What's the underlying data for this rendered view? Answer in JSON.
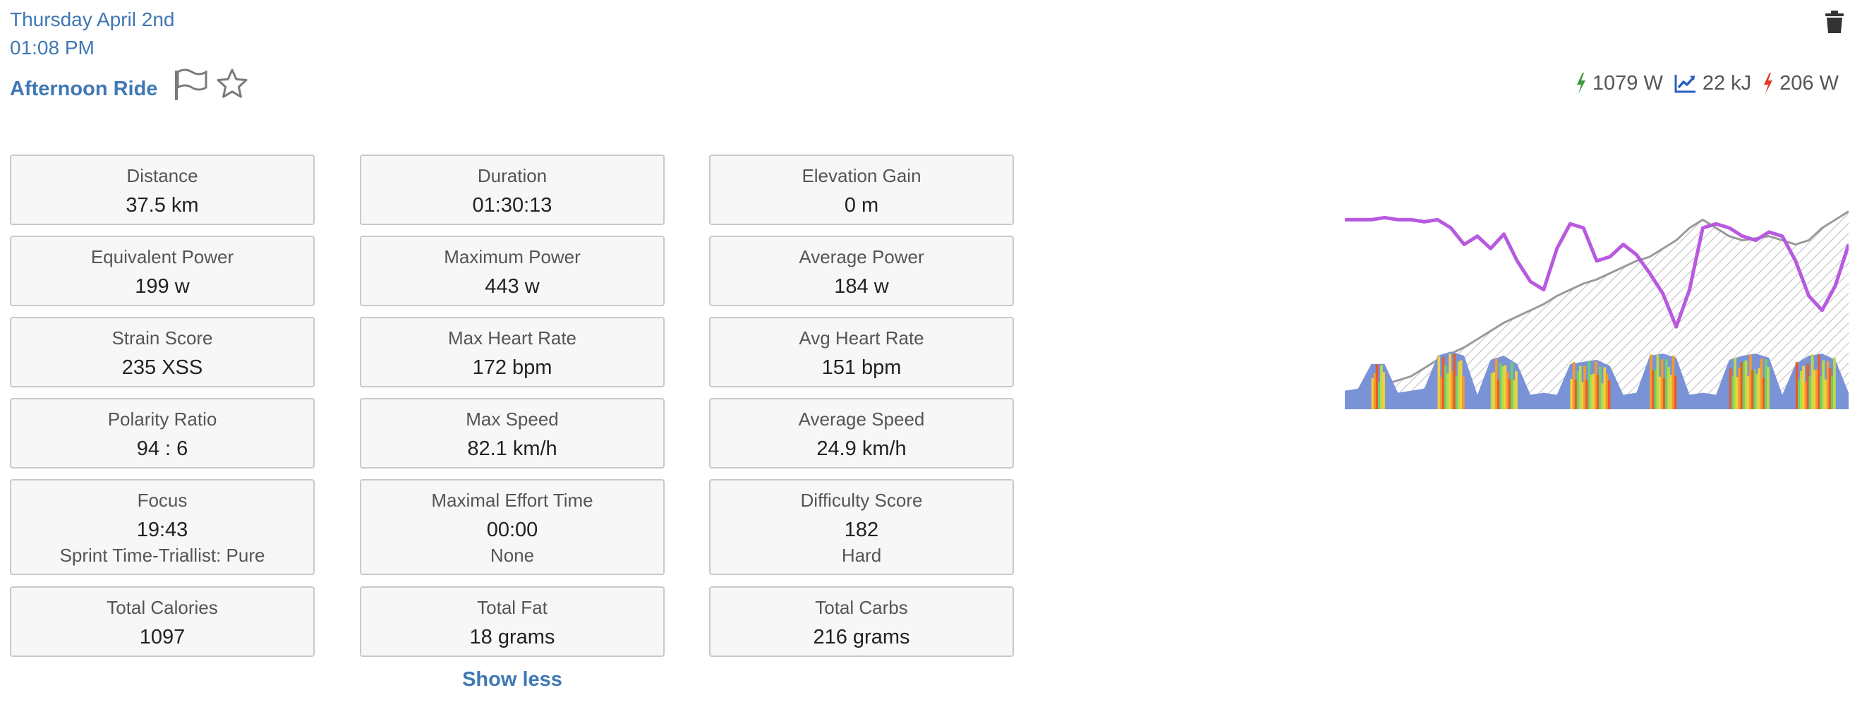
{
  "header": {
    "date": "Thursday April 2nd",
    "time": "01:08 PM",
    "title": "Afternoon Ride",
    "icons": [
      "flag-icon",
      "star-icon",
      "trash-icon"
    ]
  },
  "summary": {
    "peak_power": "1079 W",
    "work": "22 kJ",
    "threshold_power": "206 W",
    "colors": {
      "peak_power_icon": "#3a9a3a",
      "work_icon": "#2a5fc4",
      "threshold_power_icon": "#e23a2a"
    }
  },
  "metrics": [
    [
      {
        "label": "Distance",
        "value": "37.5 km"
      },
      {
        "label": "Duration",
        "value": "01:30:13"
      },
      {
        "label": "Elevation Gain",
        "value": "0 m"
      }
    ],
    [
      {
        "label": "Equivalent Power",
        "value": "199 w"
      },
      {
        "label": "Maximum Power",
        "value": "443 w"
      },
      {
        "label": "Average Power",
        "value": "184 w"
      }
    ],
    [
      {
        "label": "Strain Score",
        "value": "235 XSS"
      },
      {
        "label": "Max Heart Rate",
        "value": "172 bpm"
      },
      {
        "label": "Avg Heart Rate",
        "value": "151 bpm"
      }
    ],
    [
      {
        "label": "Polarity Ratio",
        "value": "94 : 6"
      },
      {
        "label": "Max Speed",
        "value": "82.1 km/h"
      },
      {
        "label": "Average Speed",
        "value": "24.9 km/h"
      }
    ],
    [
      {
        "label": "Focus",
        "value": "19:43",
        "sub": "Sprint Time-Triallist: Pure"
      },
      {
        "label": "Maximal Effort Time",
        "value": "00:00",
        "sub": "None"
      },
      {
        "label": "Difficulty Score",
        "value": "182",
        "sub": "Hard"
      }
    ],
    [
      {
        "label": "Total Calories",
        "value": "1097"
      },
      {
        "label": "Total Fat",
        "value": "18 grams"
      },
      {
        "label": "Total Carbs",
        "value": "216 grams"
      }
    ]
  ],
  "show_less_label": "Show less",
  "chart_data": {
    "type": "area",
    "series": [
      {
        "values": [
          0.92,
          0.92,
          0.92,
          0.93,
          0.92,
          0.92,
          0.91,
          0.92,
          0.88,
          0.8,
          0.84,
          0.78,
          0.85,
          0.72,
          0.62,
          0.58,
          0.78,
          0.9,
          0.88,
          0.72,
          0.74,
          0.8,
          0.75,
          0.66,
          0.56,
          0.4,
          0.58,
          0.88,
          0.9,
          0.88,
          0.84,
          0.82,
          0.86,
          0.84,
          0.72,
          0.55,
          0.48,
          0.6,
          0.8
        ]
      },
      {
        "values": [
          0.08,
          0.09,
          0.1,
          0.12,
          0.14,
          0.16,
          0.2,
          0.24,
          0.27,
          0.3,
          0.34,
          0.38,
          0.42,
          0.45,
          0.48,
          0.51,
          0.55,
          0.58,
          0.61,
          0.63,
          0.66,
          0.69,
          0.72,
          0.74,
          0.78,
          0.82,
          0.88,
          0.92,
          0.88,
          0.84,
          0.82,
          0.83,
          0.84,
          0.82,
          0.8,
          0.82,
          0.88,
          0.92,
          0.96
        ]
      },
      {
        "values": [
          0.09,
          0.1,
          0.22,
          0.22,
          0.08,
          0.09,
          0.1,
          0.26,
          0.28,
          0.26,
          0.07,
          0.24,
          0.26,
          0.22,
          0.07,
          0.08,
          0.07,
          0.22,
          0.23,
          0.24,
          0.21,
          0.07,
          0.08,
          0.26,
          0.27,
          0.25,
          0.07,
          0.08,
          0.07,
          0.24,
          0.26,
          0.27,
          0.25,
          0.07,
          0.22,
          0.26,
          0.27,
          0.24,
          0.08
        ]
      }
    ],
    "colors": [
      "#b85ae0",
      "#9a9a9a",
      "#7a93d6"
    ],
    "intensity_colors": [
      "#6ecf6e",
      "#b8dc4a",
      "#f0d040",
      "#f49a30",
      "#e85b2a"
    ]
  }
}
